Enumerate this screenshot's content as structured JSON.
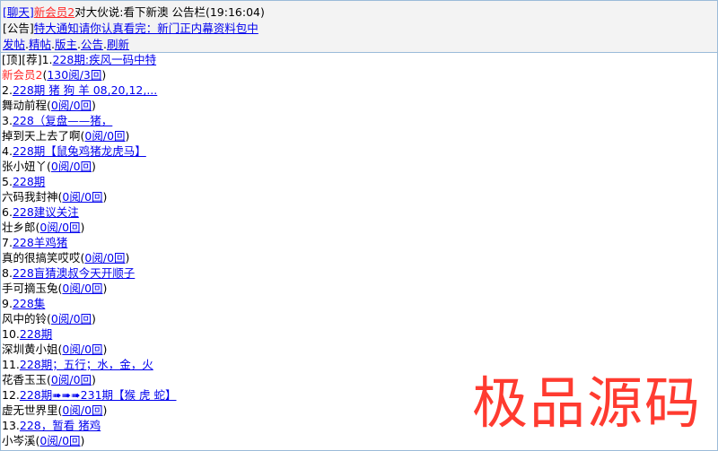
{
  "header": {
    "chat_link": "聊天",
    "user_link": "新会员2",
    "message": "对大伙说:看下新澳",
    "notice_title": "公告栏(19:16:04)",
    "notice_tag": "公告",
    "notice_link": "特大通知请你认真看完：新门正内幕资料包中",
    "nav": {
      "post": "发帖",
      "elite": "精帖",
      "moderator": "版主",
      "announce": "公告",
      "refresh": "刷新"
    }
  },
  "pinned": {
    "tag_top": "顶",
    "tag_rec": "荐",
    "number": "1.",
    "title": "228期:疾风一码中特",
    "author": "新会员2",
    "stats": "130阅/3回"
  },
  "posts": [
    {
      "number": "2.",
      "title": "228期 猪 狗 羊 08,20,12,...",
      "author": "舞动前程",
      "stats": "0阅/0回"
    },
    {
      "number": "3.",
      "title": "228（复盘——猪，",
      "author": "掉到天上去了啊",
      "stats": "0阅/0回"
    },
    {
      "number": "4.",
      "title": "228期【鼠兔鸡猪龙虎马】",
      "author": "张小妞丫",
      "stats": "0阅/0回"
    },
    {
      "number": "5.",
      "title": "228期",
      "author": "六码我封神",
      "stats": "0阅/0回"
    },
    {
      "number": "6.",
      "title": "228建议关注",
      "author": "壮乡郎",
      "stats": "0阅/0回"
    },
    {
      "number": "7.",
      "title": "228羊鸡猪",
      "author": "真的很搞笑哎哎",
      "stats": "0阅/0回"
    },
    {
      "number": "8.",
      "title": "228盲猜澳叔今天开顺子",
      "author": "手可摘玉兔",
      "stats": "0阅/0回"
    },
    {
      "number": "9.",
      "title": "228集",
      "author": "风中的铃",
      "stats": "0阅/0回"
    },
    {
      "number": "10.",
      "title": "228期",
      "author": "深圳黄小姐",
      "stats": "0阅/0回"
    },
    {
      "number": "11.",
      "title": "228期；五行；水，金，火",
      "author": "花香玉玉",
      "stats": "0阅/0回"
    },
    {
      "number": "12.",
      "title": "228期➠➠➠231期【猴 虎 蛇】",
      "author": "虚无世界里",
      "stats": "0阅/0回"
    },
    {
      "number": "13.",
      "title": "228，暂看 猪鸡",
      "author": "小岑溪",
      "stats": "0阅/0回"
    }
  ],
  "watermark": "极品源码"
}
